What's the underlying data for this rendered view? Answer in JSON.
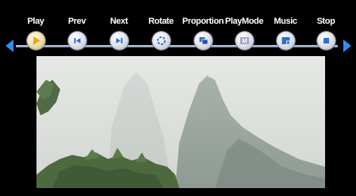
{
  "toolbar": {
    "controls": [
      {
        "label": "Play",
        "icon": "play-icon",
        "active": true
      },
      {
        "label": "Prev",
        "icon": "prev-icon"
      },
      {
        "label": "Next",
        "icon": "next-icon"
      },
      {
        "label": "Rotate",
        "icon": "rotate-icon"
      },
      {
        "label": "Proportion",
        "icon": "proportion-icon"
      },
      {
        "label": "PlayMode",
        "icon": "playmode-icon",
        "glyph": "M"
      },
      {
        "label": "Music",
        "icon": "music-icon"
      },
      {
        "label": "Stop",
        "icon": "stop-icon"
      }
    ],
    "scroll_left_icon": "left-arrow-icon",
    "scroll_right_icon": "right-arrow-icon"
  },
  "viewer": {
    "content": "photo-image"
  },
  "colors": {
    "background": "#000000",
    "accent": "#2f8df5",
    "icon_blue": "#2a6fd6",
    "play_orange": "#f0a21a"
  }
}
